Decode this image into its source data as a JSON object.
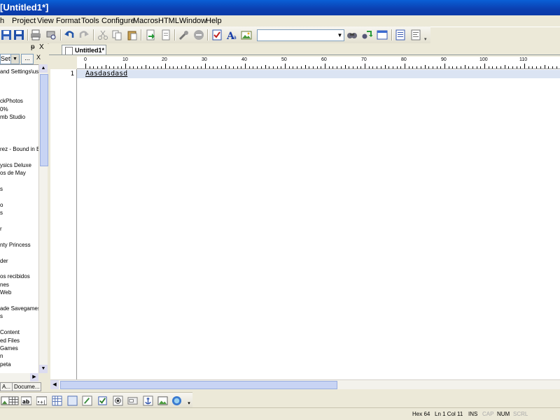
{
  "window": {
    "title": "[Untitled1*]"
  },
  "menu": [
    "h",
    "Project",
    "View",
    "Format",
    "Tools",
    "Configure",
    "Macros",
    "HTML",
    "Window",
    "Help"
  ],
  "toolbar": {
    "icons": [
      "save-icon",
      "save-all-icon",
      "print-icon",
      "print-preview-icon",
      "undo-icon",
      "redo-icon",
      "cut-icon",
      "copy-icon",
      "paste-icon",
      "export-icon",
      "import-icon",
      "wrench-icon",
      "stop-icon",
      "spellcheck-icon",
      "font-icon",
      "image-icon",
      "find-icon",
      "replace-icon",
      "window-icon",
      "list-icon",
      "properties-icon"
    ],
    "search_value": ""
  },
  "left_panel": {
    "path_value": "Setting",
    "dots_label": "...",
    "close_label": "X",
    "pin_label": "ᵽ",
    "items": [
      "and Settings\\us",
      "ckPhotos",
      "0%",
      "mb Studio",
      "rez - Bound in B",
      "ysics Deluxe",
      "os de May",
      "s",
      "o",
      "s",
      "r",
      "nty Princess",
      "der",
      "os recibidos",
      "nes",
      "Web",
      "ade Savegames",
      "s",
      "Content",
      "ed Files",
      "Games",
      "n",
      "peta"
    ],
    "tabs": [
      "A...",
      "Docume..."
    ]
  },
  "document": {
    "tab_label": "Untitled1*",
    "ruler_labels": [
      "0",
      "10",
      "20",
      "30",
      "40",
      "50",
      "60",
      "70",
      "80",
      "90",
      "100",
      "110"
    ],
    "line_number": "1",
    "text": "Aasdasdasd"
  },
  "status": {
    "hex": "Hex 64",
    "position": "Ln 1 Col 11",
    "ins": "INS",
    "cap": "CAP",
    "num": "NUM",
    "scrl": "SCRL"
  }
}
